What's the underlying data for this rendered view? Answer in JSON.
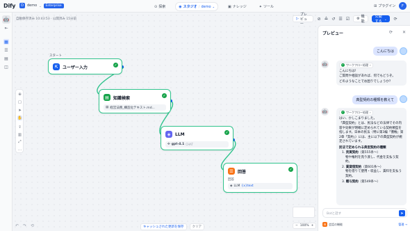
{
  "topbar": {
    "logo_main": "Dify",
    "workspace": {
      "initial": "D",
      "name": "demo",
      "badge": "Enterprise"
    },
    "nav": [
      {
        "label": "探索",
        "icon": "compass-icon"
      },
      {
        "label": "スタジオ",
        "sub": "demo",
        "icon": "studio-icon",
        "active": true
      },
      {
        "label": "ナレッジ",
        "icon": "book-icon"
      },
      {
        "label": "ツール",
        "icon": "tool-icon"
      }
    ],
    "plugin": "プラグイン",
    "user_initial": "F"
  },
  "canvas": {
    "status": "自動保存済み 10:43:53 · 公開済み 15分前",
    "toolbar": {
      "preview": "プレビュー",
      "features": "機能",
      "publish": "公開する"
    },
    "start_label": "スタート",
    "nodes": [
      {
        "title": "ユーザー入力",
        "icon": "⇱",
        "color": "#155eef"
      },
      {
        "title": "知識検索",
        "icon": "▤",
        "color": "#16a34a",
        "sub": "経営法務_構造化テキスト.md..."
      },
      {
        "title": "LLM",
        "icon": "◈",
        "color": "#6366f1",
        "sub": "gpt-4.1",
        "sub_tag": "CHAT"
      },
      {
        "title": "回答",
        "icon": "☰",
        "color": "#f97316",
        "sub_label": "回答",
        "sub": "LLM",
        "sub_var": "{x}text"
      }
    ],
    "bottom_pills": [
      "キャッシュされた更新を保存",
      "クリア"
    ],
    "zoom": "100%"
  },
  "preview": {
    "title": "プレビュー",
    "greeting": "こんにちは",
    "workflow_label": "ワークフロー処理",
    "bot1": [
      "こんにちは！",
      "ご質問や相談があれば、何でもどうぞ。",
      "どのようなことでお困りでしょうか？"
    ],
    "question": "典型契約の種類を教えて",
    "bot2": {
      "intro": "はい、かしこまりました。",
      "body": "「典型契約」とは、民法などの法律でその内容や効果が明確に定められている契約類型を指します。日本の民法（特に第3編「債権」第2章「契約」）には、主に以下の典型契約が規定されています。",
      "heading": "民法で定められる典型契約の種類",
      "items": [
        {
          "num": "1.",
          "name": "売買契約",
          "ref": "（第555条〜）",
          "desc": "物や権利を売り渡し、代金を支払う契約。"
        },
        {
          "num": "2.",
          "name": "賃貸借契約",
          "ref": "（第601条〜）",
          "desc": "物を借りて使用・収益し、賃料を支払う契約。"
        },
        {
          "num": "3.",
          "name": "贈与契約",
          "ref": "（第549条〜）",
          "desc": ""
        }
      ]
    },
    "input_placeholder": "Botと話す",
    "footer_label": "会話の機能",
    "footer_link": "管理"
  }
}
